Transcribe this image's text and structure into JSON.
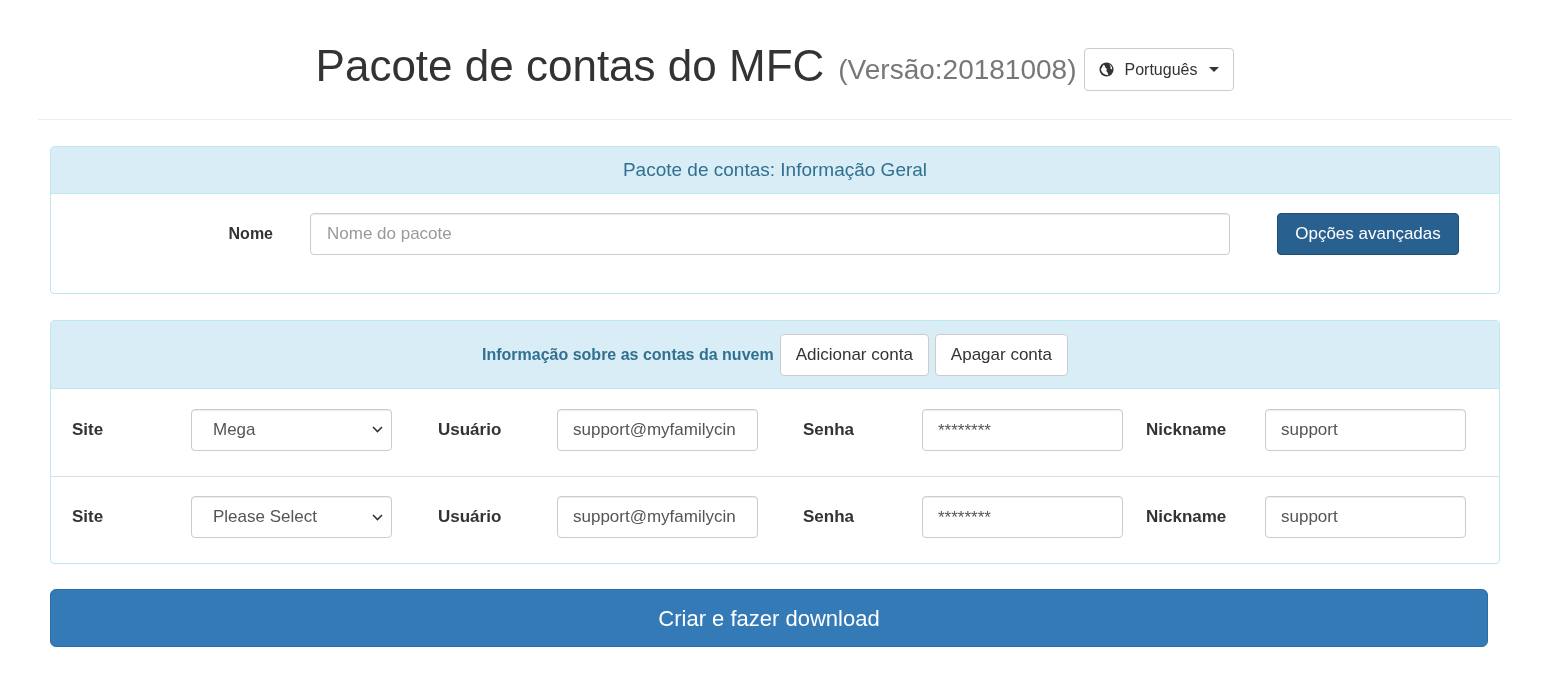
{
  "header": {
    "title": "Pacote de contas do MFC",
    "version": "(Versão:20181008)",
    "language_button": "Português"
  },
  "general_panel": {
    "heading": "Pacote de contas: Informação Geral",
    "name_label": "Nome",
    "name_placeholder": "Nome do pacote",
    "advanced_button": "Opções avançadas"
  },
  "accounts_panel": {
    "heading": "Informação sobre as contas da nuvem",
    "add_button": "Adicionar conta",
    "delete_button": "Apagar conta",
    "rows": [
      {
        "site_label": "Site",
        "site": "Mega",
        "user_label": "Usuário",
        "user": "support@myfamilycin",
        "password_label": "Senha",
        "password": "********",
        "nickname_label": "Nickname",
        "nickname": "support"
      },
      {
        "site_label": "Site",
        "site": "Please Select",
        "user_label": "Usuário",
        "user": "support@myfamilycin",
        "password_label": "Senha",
        "password": "********",
        "nickname_label": "Nickname",
        "nickname": "support"
      }
    ]
  },
  "submit_button": "Criar e fazer download"
}
